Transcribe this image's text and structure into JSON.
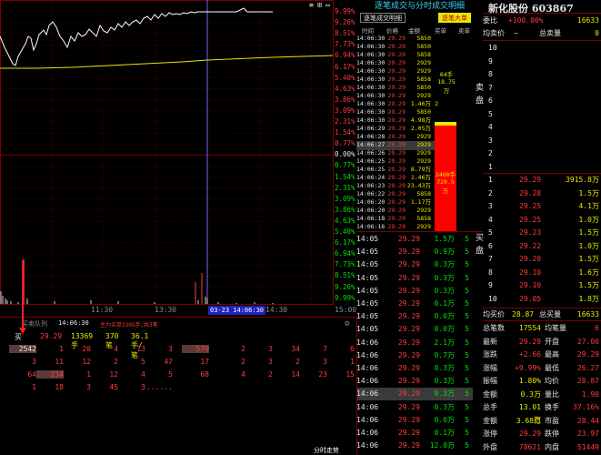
{
  "chart": {
    "pct_labels": [
      "9.99%",
      "9.26%",
      "8.51%",
      "7.73%",
      "6.94%",
      "6.17%",
      "5.40%",
      "4.63%",
      "3.86%",
      "3.09%",
      "2.31%",
      "1.54%",
      "0.77%",
      "0.00%",
      "0.77%",
      "1.54%",
      "2.31%",
      "3.09%",
      "3.86%",
      "4.63%",
      "5.40%",
      "6.17%",
      "6.94%",
      "7.73%",
      "8.51%",
      "9.26%",
      "9.99%"
    ],
    "time_labels": [
      "11:30",
      "13:30",
      "14:30",
      "15:00"
    ],
    "cursor_label": "03-23 14:06:30",
    "toolbar_icons": [
      "≡",
      "⊞",
      "▭"
    ]
  },
  "mid": {
    "title": "逐笔成交与分时成交明细",
    "tab_list": "逐笔成交明细",
    "tab_big": "逐笔大单",
    "headers": [
      "时间",
      "价格",
      "金额",
      "买单",
      "卖单"
    ],
    "tick_rows": [
      [
        "14:06:30",
        "29.29",
        "5850"
      ],
      [
        "14:06:30",
        "29.29",
        "5850"
      ],
      [
        "14:06:30",
        "29.29",
        "5858"
      ],
      [
        "14:06:30",
        "29.29",
        "2929"
      ],
      [
        "14:06:30",
        "29.29",
        "2929"
      ],
      [
        "14:06:30",
        "29.29",
        "5858"
      ],
      [
        "14:06:30",
        "29.29",
        "5850"
      ],
      [
        "14:06:30",
        "29.29",
        "2929"
      ],
      [
        "14:06:30",
        "29.29",
        "1.46万"
      ],
      [
        "14:06:30",
        "29.29",
        "5850"
      ],
      [
        "14:06:30",
        "29.29",
        "4.98万"
      ],
      [
        "14:06:29",
        "29.29",
        "2.05万"
      ],
      [
        "14:06:28",
        "29.29",
        "2929"
      ],
      [
        "14:06:27",
        "29.29",
        "2929"
      ],
      [
        "14:06:26",
        "29.29",
        "2929"
      ],
      [
        "14:06:25",
        "29.29",
        "2929"
      ],
      [
        "14:06:25",
        "29.29",
        "8.79万"
      ],
      [
        "14:06:24",
        "29.29",
        "1.46万"
      ],
      [
        "14:06:23",
        "29.29",
        "23.43万"
      ],
      [
        "14:06:22",
        "29.29",
        "5858"
      ],
      [
        "14:06:20",
        "29.29",
        "1.17万"
      ],
      [
        "14:06:20",
        "29.29",
        "2929"
      ],
      [
        "14:06:18",
        "29.29",
        "5858"
      ],
      [
        "14:06:16",
        "29.29",
        "2929"
      ]
    ],
    "tick_counts": [
      "",
      "",
      "",
      "",
      "",
      "",
      "",
      "",
      "2",
      "",
      "",
      "",
      "",
      "",
      "",
      "",
      "3",
      "",
      "",
      "",
      "",
      "",
      "",
      ""
    ],
    "buy_order_small": {
      "qty": "64手",
      "amt": "18.75万"
    },
    "buy_order_big": {
      "qty": "2460手",
      "amt": "720.5万"
    },
    "book_rows": [
      [
        "14:05",
        "29.29",
        "1.5万",
        "5"
      ],
      [
        "14:05",
        "29.29",
        "0.9万",
        "5"
      ],
      [
        "14:05",
        "29.29",
        "0.3万",
        "5"
      ],
      [
        "14:05",
        "29.29",
        "0.3万",
        "5"
      ],
      [
        "14:05",
        "29.29",
        "0.3万",
        "5"
      ],
      [
        "14:05",
        "29.29",
        "0.1万",
        "5"
      ],
      [
        "14:05",
        "29.29",
        "0.0万",
        "5"
      ],
      [
        "14:05",
        "29.29",
        "0.0万",
        "5"
      ],
      [
        "14:06",
        "29.29",
        "2.1万",
        "5"
      ],
      [
        "14:06",
        "29.29",
        "0.7万",
        "5"
      ],
      [
        "14:06",
        "29.29",
        "0.3万",
        "5"
      ],
      [
        "14:06",
        "29.29",
        "0.3万",
        "5"
      ],
      [
        "14:06",
        "29.29",
        "0.3万",
        "5"
      ],
      [
        "14:06",
        "29.29",
        "0.3万",
        "5"
      ],
      [
        "14:06",
        "29.29",
        "0.0万",
        "5"
      ],
      [
        "14:06",
        "29.29",
        "0.1万",
        "5"
      ],
      [
        "14:06",
        "29.29",
        "12.0万",
        "5"
      ]
    ],
    "bottom_btn": "分时走势"
  },
  "right": {
    "stock_title": "新化股份 603867",
    "weibi_label": "委比",
    "weibi_value": "+100.00%",
    "weibi_num": "16633",
    "avg_label": "均卖价",
    "avg_dash": "—",
    "total_sell_label": "总卖量",
    "total_sell": "0",
    "sell_side_label": "卖盘",
    "sell_levels": [
      "10",
      "9",
      "8",
      "7",
      "6",
      "5",
      "4",
      "3",
      "2",
      "1"
    ],
    "buy_rows": [
      [
        "1",
        "29.29",
        "3915.8万"
      ],
      [
        "2",
        "29.28",
        "1.5万"
      ],
      [
        "3",
        "29.25",
        "4.1万"
      ],
      [
        "4",
        "29.25",
        "1.0万"
      ],
      [
        "5",
        "29.23",
        "1.5万"
      ],
      [
        "6",
        "29.22",
        "1.0万"
      ],
      [
        "7",
        "29.20",
        "1.5万"
      ],
      [
        "8",
        "29.10",
        "1.6万"
      ],
      [
        "9",
        "29.10",
        "1.5万"
      ],
      [
        "10",
        "29.05",
        "1.8万"
      ]
    ],
    "buy_side_label": "买盘",
    "avg_buy_label": "均买价",
    "avg_buy": "28.87",
    "total_buy_label": "总买量",
    "total_buy": "16633",
    "stats": [
      [
        "总笔数",
        "17554",
        "均笔量",
        "6"
      ],
      [
        "最新",
        "29.29",
        "开盘",
        "27.00"
      ],
      [
        "涨跌",
        "+2.66",
        "最高",
        "29.29"
      ],
      [
        "涨幅",
        "+9.99%",
        "最低",
        "26.27"
      ],
      [
        "振幅",
        "1.80%",
        "均价",
        "28.87"
      ],
      [
        "金额",
        "0.3万",
        "量比",
        "1.90"
      ],
      [
        "总手",
        "13.01万",
        "换手",
        "37.16%"
      ],
      [
        "金额",
        "3.68亿",
        "市盈",
        "28.44"
      ],
      [
        "涨停",
        "29.29",
        "跌停",
        "23.97"
      ],
      [
        "外盘",
        "78621",
        "内盘",
        "51449"
      ]
    ]
  },
  "queue": {
    "title": "买卖队列",
    "time": "14:06:30",
    "info": "主力买单3305手,共3笔",
    "side": "买一",
    "price": "29.29",
    "qty": "13369手",
    "orders": "370笔",
    "avg": "36.1手/笔",
    "grid": [
      [
        "2542",
        "1",
        "20",
        "4",
        "13",
        "3",
        "579",
        "2",
        "3",
        "34",
        "7",
        "6"
      ],
      [
        "3",
        "11",
        "12",
        "2",
        "5",
        "47",
        "17",
        "2",
        "3",
        "2",
        "3",
        "1"
      ],
      [
        "64",
        "234",
        "1",
        "12",
        "4",
        "5",
        "68",
        "4",
        "2",
        "14",
        "23",
        "15"
      ],
      [
        "1",
        "18",
        "3",
        "45",
        "3",
        "......",
        "",
        "",
        "",
        "",
        "",
        ""
      ]
    ],
    "colors": {
      "highlight": "#5a3a3a"
    }
  },
  "colors": {
    "up": "#ff3b3b",
    "down": "#00e000",
    "grid": "#7a0000",
    "cursor": "#6a6aff"
  }
}
